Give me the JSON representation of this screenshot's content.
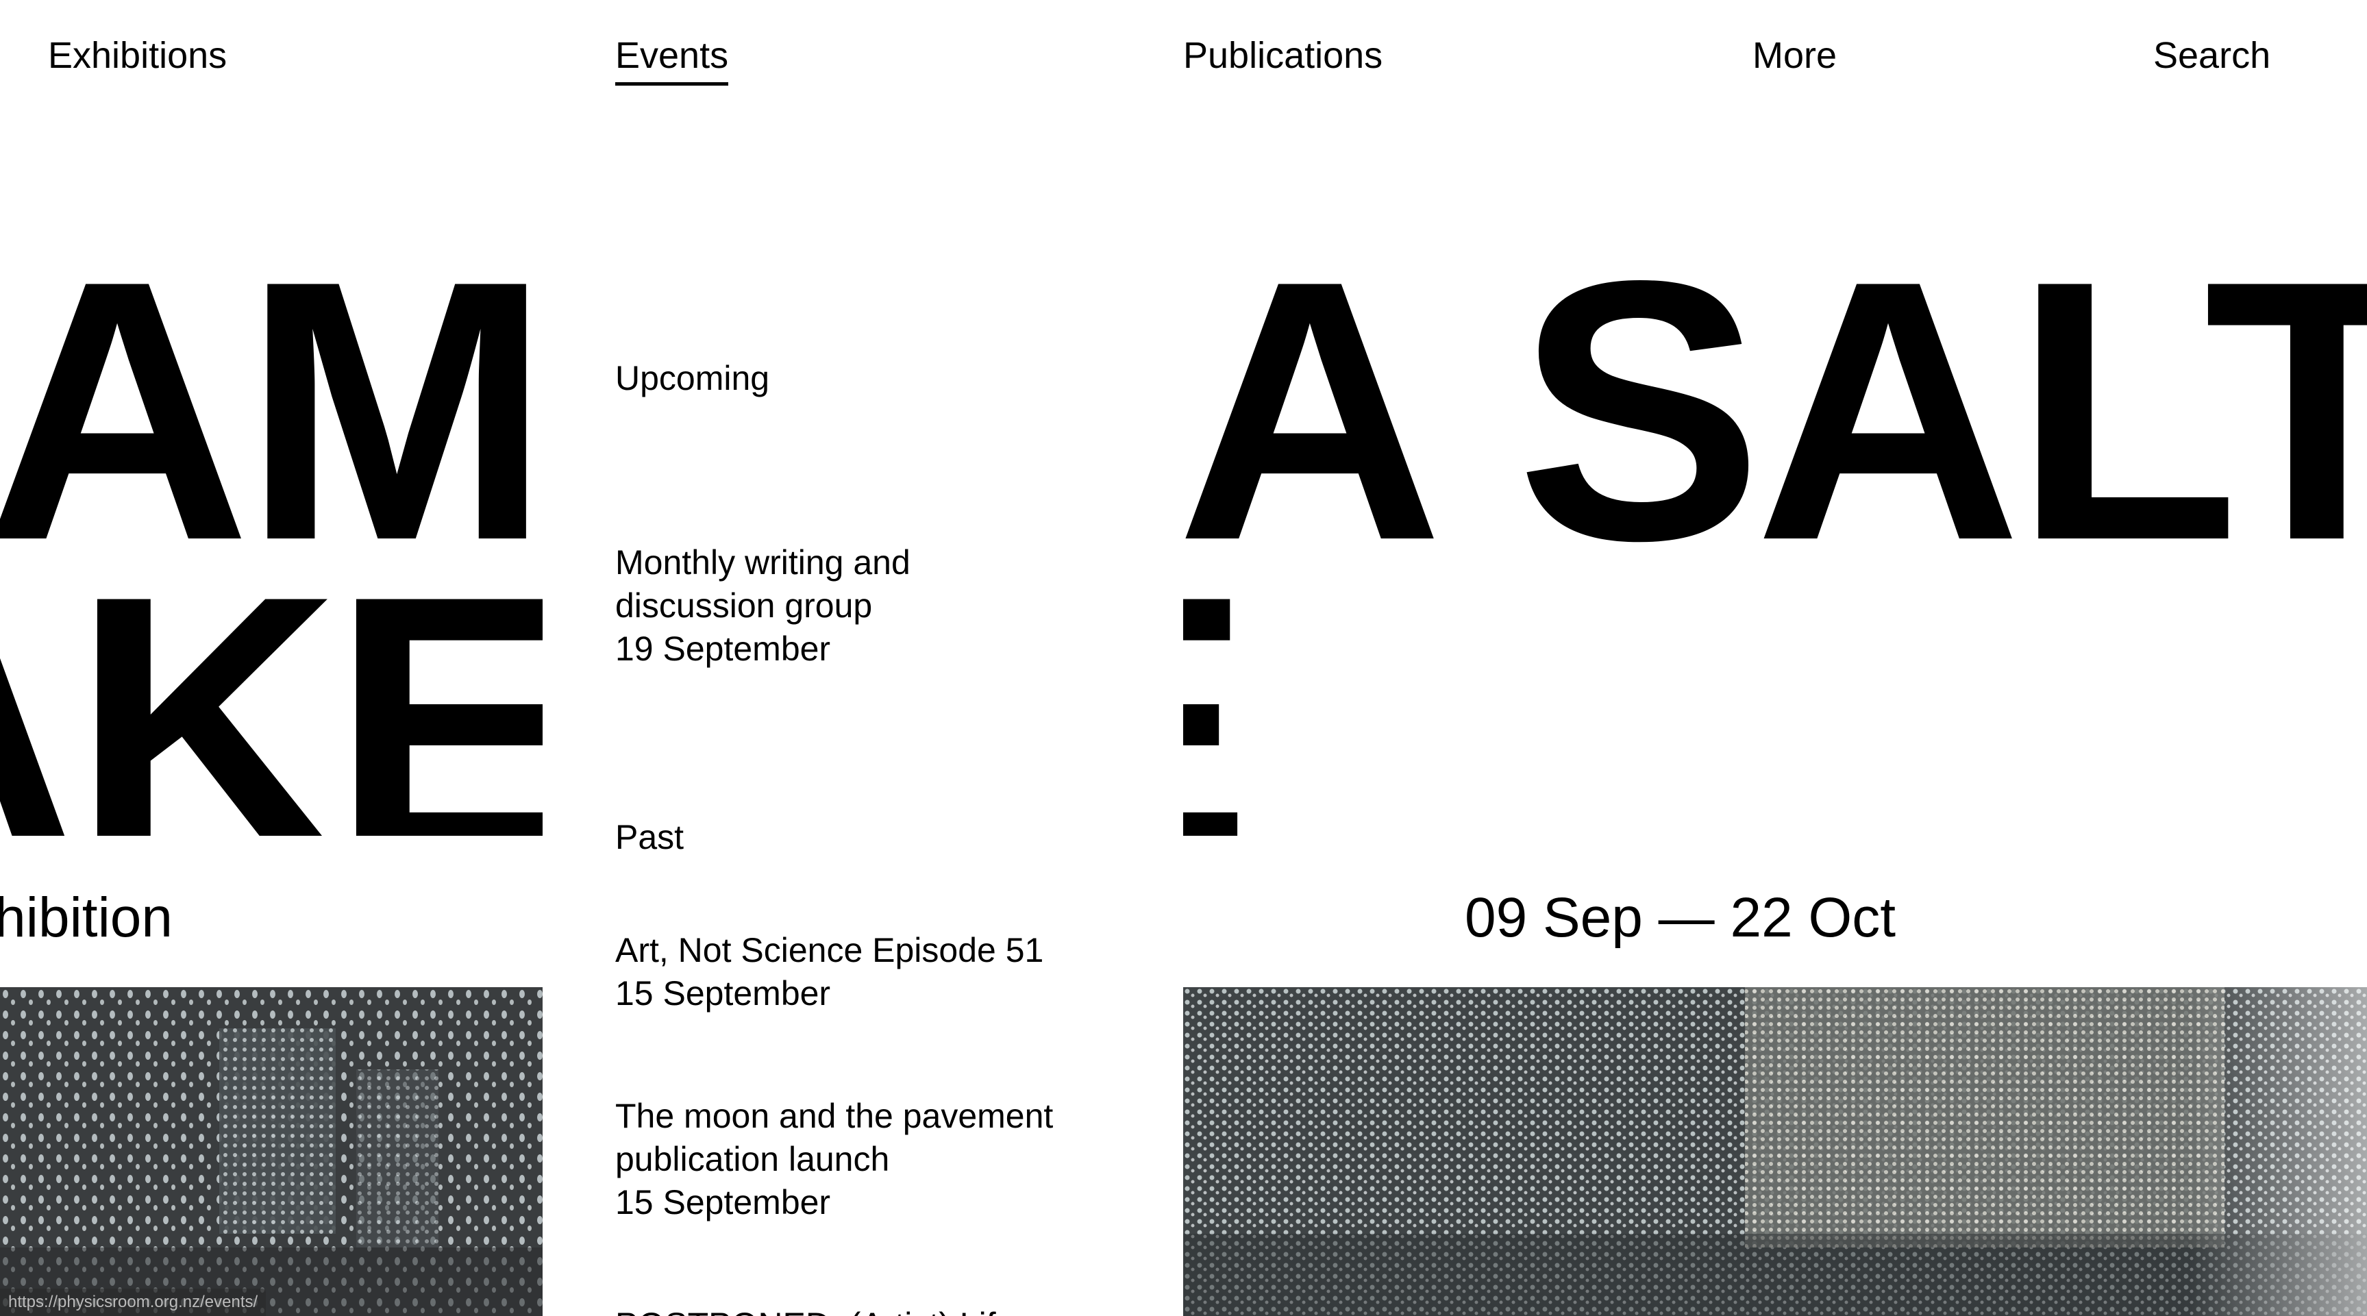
{
  "nav": {
    "exhibitions": "Exhibitions",
    "events": "Events",
    "publications": "Publications",
    "more": "More",
    "search": "Search"
  },
  "left_exhibition": {
    "title_line1": "AM",
    "title_line2": "AKE",
    "subtitle": "hibition"
  },
  "events": {
    "upcoming_label": "Upcoming",
    "upcoming": [
      {
        "title": "Monthly writing and discussion group",
        "date": "19 September"
      }
    ],
    "past_label": "Past",
    "past": [
      {
        "title": "Art, Not Science Episode 51",
        "date": "15 September"
      },
      {
        "title": "The moon and the pavement publication launch",
        "date": "15 September"
      },
      {
        "title": "POSTPONED: (Artist) Lif",
        "date": ""
      }
    ]
  },
  "right_exhibition": {
    "title_line1": "A SALT",
    "title_line2": "E",
    "dates": "09 Sep — 22 Oct"
  },
  "status_bar": {
    "url": "https://physicsroom.org.nz/events/"
  },
  "colors": {
    "text": "#000000",
    "background": "#ffffff",
    "photo_base": "#3a3d3f"
  }
}
